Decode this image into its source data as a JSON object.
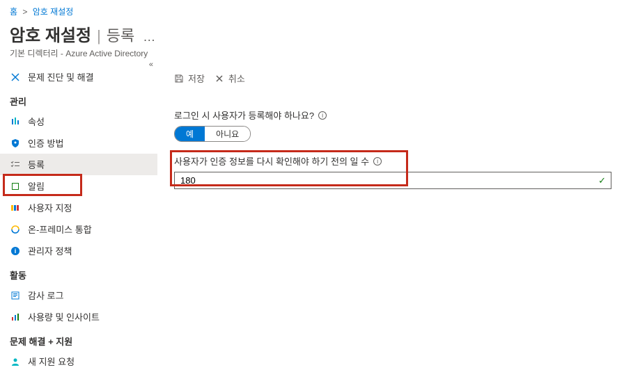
{
  "breadcrumb": {
    "home": "홈",
    "current": "암호 재설정"
  },
  "header": {
    "title": "암호 재설정",
    "section": "등록",
    "subtitle": "기본 디렉터리 - Azure Active Directory"
  },
  "sidebar": {
    "diagnose": "문제 진단 및 해결",
    "group_manage": "관리",
    "items_manage": [
      "속성",
      "인증 방법",
      "등록",
      "알림",
      "사용자 지정",
      "온-프레미스 통합",
      "관리자 정책"
    ],
    "group_activity": "활동",
    "items_activity": [
      "감사 로그",
      "사용량 및 인사이트"
    ],
    "group_support": "문제 해결 + 지원",
    "items_support": [
      "새 지원 요청"
    ]
  },
  "toolbar": {
    "save": "저장",
    "discard": "취소"
  },
  "form": {
    "require_register_label": "로그인 시 사용자가 등록해야 하나요?",
    "yes": "예",
    "no": "아니요",
    "reconfirm_label": "사용자가 인증 정보를 다시 확인해야 하기 전의 일 수",
    "reconfirm_value": "180"
  }
}
